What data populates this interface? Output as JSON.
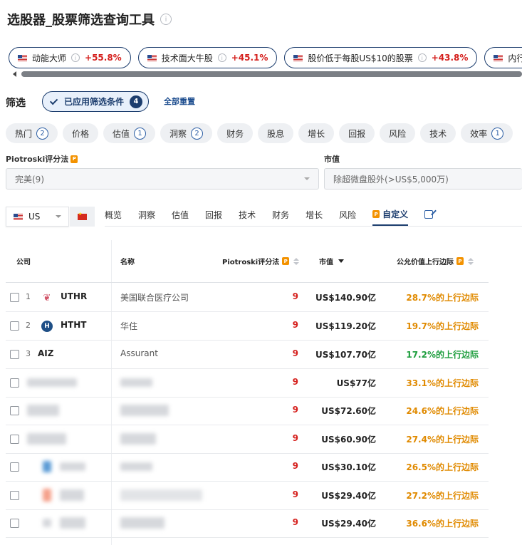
{
  "page_title": "选股器_股票筛选查询工具",
  "screens": [
    {
      "name": "动能大师",
      "change": "+55.8%"
    },
    {
      "name": "技术面大牛股",
      "change": "+45.1%"
    },
    {
      "name": "股价低于每股US$10的股票",
      "change": "+43.8%"
    },
    {
      "name": "内行"
    }
  ],
  "filter": {
    "label": "筛选",
    "applied_label": "已应用筛选条件",
    "applied_count": "4",
    "reset_label": "全部重置"
  },
  "categories": [
    {
      "label": "热门",
      "count": "2"
    },
    {
      "label": "价格"
    },
    {
      "label": "估值",
      "count": "1"
    },
    {
      "label": "洞察",
      "count": "2"
    },
    {
      "label": "财务"
    },
    {
      "label": "股息"
    },
    {
      "label": "增长"
    },
    {
      "label": "回报"
    },
    {
      "label": "风险"
    },
    {
      "label": "技术"
    },
    {
      "label": "效率",
      "count": "1"
    }
  ],
  "piotroski_filter": {
    "label": "Piotroski评分法",
    "value": "完美(9)"
  },
  "marketcap_filter": {
    "label": "市值",
    "value": "除超微盘股外(>US$5,000万)"
  },
  "region": {
    "value": "US"
  },
  "tabs": [
    "概览",
    "洞察",
    "估值",
    "回报",
    "技术",
    "财务",
    "增长",
    "风险",
    "自定义"
  ],
  "active_tab": "自定义",
  "columns": {
    "company": "公司",
    "name": "名称",
    "piotroski": "Piotroski评分法",
    "market_cap": "市值",
    "upside": "公允价值上行边际"
  },
  "rows": [
    {
      "rank": "1",
      "ticker": "UTHR",
      "name": "美国联合医疗公司",
      "score": "9",
      "market_cap": "US$140.90亿",
      "upside": "28.7%的上行边际",
      "upside_color": "#e08a00"
    },
    {
      "rank": "2",
      "ticker": "HTHT",
      "name": "华住",
      "score": "9",
      "market_cap": "US$119.20亿",
      "upside": "19.7%的上行边际",
      "upside_color": "#e08a00"
    },
    {
      "rank": "3",
      "ticker": "AIZ",
      "name": "Assurant",
      "score": "9",
      "market_cap": "US$107.70亿",
      "upside": "17.2%的上行边际",
      "upside_color": "#1e9e3e"
    },
    {
      "score": "9",
      "market_cap": "US$77亿",
      "upside": "33.1%的上行边际",
      "upside_color": "#e08a00"
    },
    {
      "score": "9",
      "market_cap": "US$72.60亿",
      "upside": "24.6%的上行边际",
      "upside_color": "#e08a00"
    },
    {
      "score": "9",
      "market_cap": "US$60.90亿",
      "upside": "27.4%的上行边际",
      "upside_color": "#e08a00"
    },
    {
      "score": "9",
      "market_cap": "US$30.10亿",
      "upside": "26.5%的上行边际",
      "upside_color": "#e08a00"
    },
    {
      "score": "9",
      "market_cap": "US$29.40亿",
      "upside": "27.2%的上行边际",
      "upside_color": "#e08a00"
    },
    {
      "score": "9",
      "market_cap": "US$29.40亿",
      "upside": "36.6%的上行边际",
      "upside_color": "#e08a00"
    }
  ],
  "icons": {
    "info": "info-icon",
    "piotroski": "piotroski-icon",
    "edit": "edit-icon"
  }
}
